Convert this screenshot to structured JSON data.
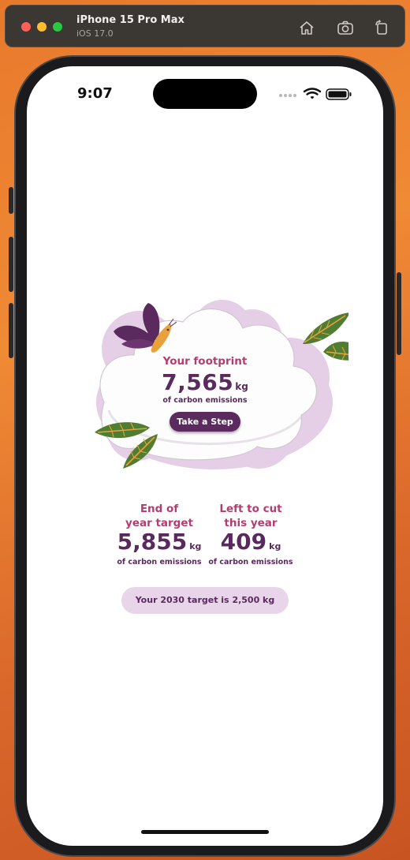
{
  "simulator": {
    "device": "iPhone 15 Pro Max",
    "os": "iOS 17.0",
    "icons": [
      "home-icon",
      "screenshot-icon",
      "rotate-icon"
    ]
  },
  "status_bar": {
    "time": "9:07",
    "icons": [
      "signal-dots-icon",
      "wifi-icon",
      "battery-icon"
    ]
  },
  "footprint": {
    "title": "Your footprint",
    "value": "7,565",
    "unit": "kg",
    "caption": "of carbon emissions",
    "button_label": "Take a Step"
  },
  "stats": [
    {
      "title": "End of year target",
      "line1": "End of",
      "line2": "year target",
      "value": "5,855",
      "unit": "kg",
      "caption": "of carbon emissions"
    },
    {
      "title": "Left to cut this year",
      "line1": "Left to cut",
      "line2": "this year",
      "value": "409",
      "unit": "kg",
      "caption": "of carbon emissions"
    }
  ],
  "target_2030": "Your 2030 target is 2,500 kg",
  "colors": {
    "accent_pink": "#b53c6f",
    "deep_purple": "#5a2a5e",
    "button_purple": "#5b2a5f",
    "lavender": "#e9d5ea",
    "leaf_green": "#4f7d32",
    "butterfly_orange": "#e9a23b"
  }
}
